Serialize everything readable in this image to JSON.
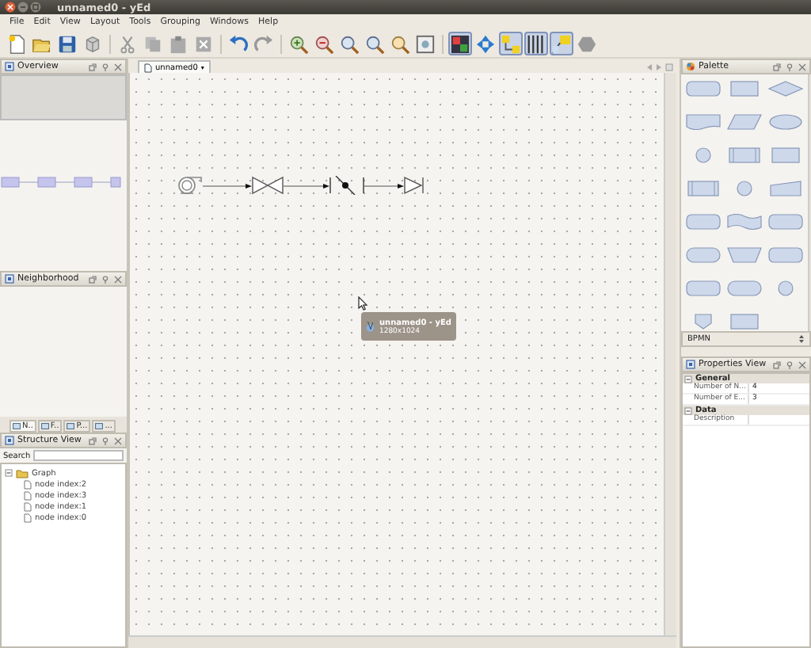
{
  "window": {
    "title": "unnamed0 - yEd"
  },
  "menu": [
    "File",
    "Edit",
    "View",
    "Layout",
    "Tools",
    "Grouping",
    "Windows",
    "Help"
  ],
  "toolbar": [
    {
      "kind": "new",
      "selected": false
    },
    {
      "kind": "open",
      "selected": false
    },
    {
      "kind": "save",
      "selected": false
    },
    {
      "kind": "export",
      "selected": false
    },
    {
      "kind": "sep"
    },
    {
      "kind": "cut",
      "selected": false
    },
    {
      "kind": "copy",
      "selected": false
    },
    {
      "kind": "paste",
      "selected": false
    },
    {
      "kind": "delete",
      "selected": false
    },
    {
      "kind": "sep"
    },
    {
      "kind": "undo",
      "selected": false
    },
    {
      "kind": "redo",
      "selected": false
    },
    {
      "kind": "sep"
    },
    {
      "kind": "zoom-in",
      "selected": false
    },
    {
      "kind": "zoom-out",
      "selected": false
    },
    {
      "kind": "zoom",
      "selected": false
    },
    {
      "kind": "zoom",
      "selected": false
    },
    {
      "kind": "zoom-area",
      "selected": false
    },
    {
      "kind": "fit",
      "selected": false
    },
    {
      "kind": "sep"
    },
    {
      "kind": "grid",
      "selected": true
    },
    {
      "kind": "move",
      "selected": false
    },
    {
      "kind": "nodes",
      "selected": true
    },
    {
      "kind": "bars",
      "selected": true
    },
    {
      "kind": "label",
      "selected": true
    },
    {
      "kind": "hexagon",
      "selected": false
    }
  ],
  "overview": {
    "title": "Overview"
  },
  "neighborhood": {
    "title": "Neighborhood",
    "tabs": [
      {
        "label": "N..",
        "selected": true
      },
      {
        "label": "F..",
        "selected": false
      },
      {
        "label": "P...",
        "selected": false
      },
      {
        "label": "...",
        "selected": false
      }
    ]
  },
  "structure_view": {
    "title": "Structure View",
    "search_label": "Search",
    "tree": [
      {
        "label": "Graph",
        "expanded": true,
        "children": [
          {
            "label": "node index:2"
          },
          {
            "label": "node index:3"
          },
          {
            "label": "node index:1"
          },
          {
            "label": "node index:0"
          }
        ]
      }
    ]
  },
  "document_tab": {
    "label": "unnamed0",
    "caret": "▾"
  },
  "diagram": {
    "nodes": [
      {
        "kind": "pump"
      },
      {
        "kind": "valve"
      },
      {
        "kind": "check-valve"
      },
      {
        "kind": "diode"
      }
    ]
  },
  "drag_indicator": {
    "title": "unnamed0 - yEd",
    "subtitle": "1280x1024"
  },
  "palette": {
    "title": "Palette",
    "shapes": [
      {
        "kind": "rounded"
      },
      {
        "kind": "rect"
      },
      {
        "kind": "diamond"
      },
      {
        "kind": "document"
      },
      {
        "kind": "parallelogram"
      },
      {
        "kind": "ellipse"
      },
      {
        "kind": "circle"
      },
      {
        "kind": "process"
      },
      {
        "kind": "rect"
      },
      {
        "kind": "process"
      },
      {
        "kind": "circle"
      },
      {
        "kind": "manual"
      },
      {
        "kind": "rounded"
      },
      {
        "kind": "wave"
      },
      {
        "kind": "rounded"
      },
      {
        "kind": "stadium"
      },
      {
        "kind": "trapezoid"
      },
      {
        "kind": "rounded"
      },
      {
        "kind": "rounded"
      },
      {
        "kind": "stadium"
      },
      {
        "kind": "circle"
      },
      {
        "kind": "shield"
      },
      {
        "kind": "rect"
      }
    ],
    "section": "BPMN"
  },
  "properties": {
    "title": "Properties View",
    "groups": [
      {
        "label": "General",
        "expanded": true,
        "rows": [
          {
            "name": "Number of N...",
            "value": "4"
          },
          {
            "name": "Number of E...",
            "value": "3"
          }
        ]
      },
      {
        "label": "Data",
        "expanded": true,
        "rows": [
          {
            "name": "Description"
          }
        ]
      }
    ]
  }
}
